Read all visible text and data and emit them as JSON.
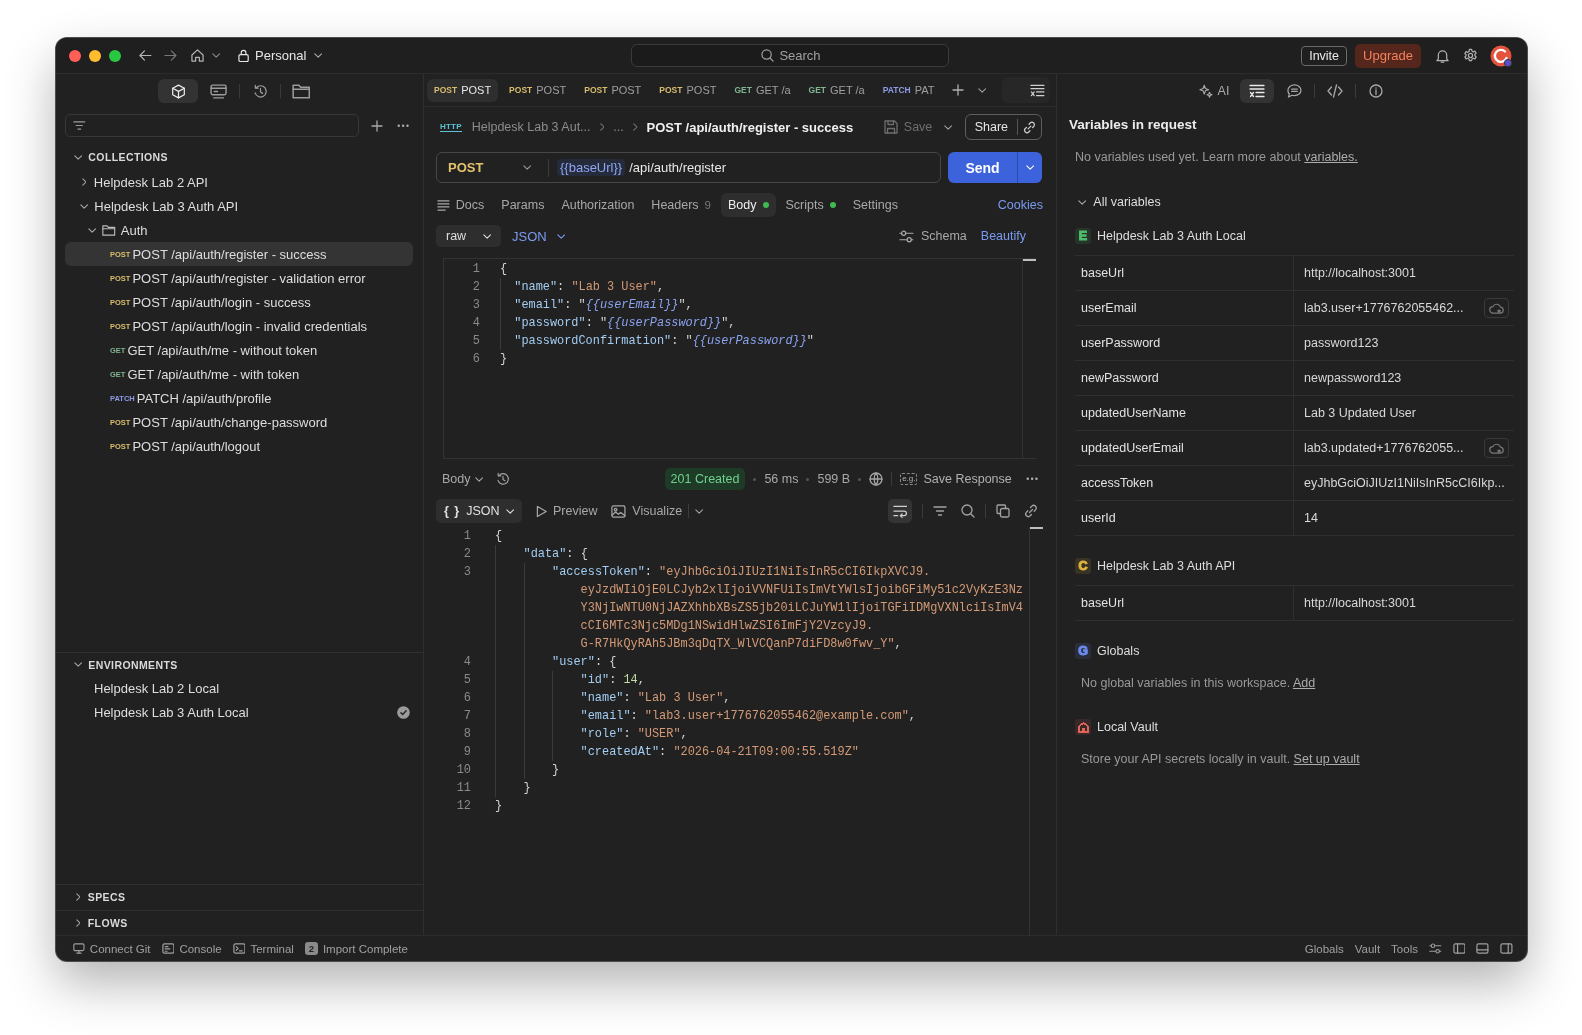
{
  "titlebar": {
    "workspace": "Personal",
    "search": {
      "placeholder": "Search"
    },
    "invite": "Invite",
    "upgrade": "Upgrade"
  },
  "sidebar": {
    "nav": [
      {
        "selected": true
      },
      {
        "selected": false
      },
      {
        "selected": false
      },
      {
        "selected": false
      }
    ],
    "collections": {
      "title": "COLLECTIONS",
      "expanded": true,
      "items": [
        {
          "kind": "collection",
          "name": "Helpdesk Lab 2 API",
          "expanded": false
        },
        {
          "kind": "collection",
          "name": "Helpdesk Lab 3 Auth API",
          "expanded": true,
          "children": [
            {
              "kind": "folder",
              "name": "Auth",
              "expanded": true,
              "children": [
                {
                  "kind": "request",
                  "method": "POST",
                  "color": "#d8bd6e",
                  "name": "POST /api/auth/register - success",
                  "selected": true
                },
                {
                  "kind": "request",
                  "method": "POST",
                  "color": "#d8bd6e",
                  "name": "POST /api/auth/register - validation error",
                  "selected": false
                },
                {
                  "kind": "request",
                  "method": "POST",
                  "color": "#d8bd6e",
                  "name": "POST /api/auth/login - success",
                  "selected": false
                },
                {
                  "kind": "request",
                  "method": "POST",
                  "color": "#d8bd6e",
                  "name": "POST /api/auth/login - invalid credentials",
                  "selected": false
                },
                {
                  "kind": "request",
                  "method": "GET",
                  "color": "#7eb48e",
                  "name": "GET /api/auth/me - without token",
                  "selected": false
                },
                {
                  "kind": "request",
                  "method": "GET",
                  "color": "#7eb48e",
                  "name": "GET /api/auth/me - with token",
                  "selected": false
                },
                {
                  "kind": "request",
                  "method": "PATCH",
                  "color": "#8e9be6",
                  "name": "PATCH /api/auth/profile",
                  "selected": false
                },
                {
                  "kind": "request",
                  "method": "POST",
                  "color": "#d8bd6e",
                  "name": "POST /api/auth/change-password",
                  "selected": false
                },
                {
                  "kind": "request",
                  "method": "POST",
                  "color": "#d8bd6e",
                  "name": "POST /api/auth/logout",
                  "selected": false
                }
              ]
            }
          ]
        }
      ]
    },
    "environments": {
      "title": "ENVIRONMENTS",
      "expanded": true,
      "items": [
        {
          "name": "Helpdesk Lab 2 Local",
          "active": false
        },
        {
          "name": "Helpdesk Lab 3 Auth Local",
          "active": true
        }
      ]
    },
    "sections": [
      {
        "title": "SPECS",
        "expanded": false
      },
      {
        "title": "FLOWS",
        "expanded": false
      }
    ]
  },
  "tabs": [
    {
      "method": "POST",
      "color": "#d8bd6e",
      "label": "POST",
      "selected": true
    },
    {
      "method": "POST",
      "color": "#d8bd6e",
      "label": "POST",
      "selected": false
    },
    {
      "method": "POST",
      "color": "#d8bd6e",
      "label": "POST",
      "selected": false
    },
    {
      "method": "POST",
      "color": "#d8bd6e",
      "label": "POST",
      "selected": false
    },
    {
      "method": "GET",
      "color": "#7eb48e",
      "label": "GET /a",
      "selected": false
    },
    {
      "method": "GET",
      "color": "#7eb48e",
      "label": "GET /a",
      "selected": false
    },
    {
      "method": "PATCH",
      "color": "#8e9be6",
      "label": "PAT",
      "selected": false
    }
  ],
  "request": {
    "protocol": "HTTP",
    "breadcrumb": [
      "Helpdesk Lab 3 Aut...",
      "..."
    ],
    "title": "POST /api/auth/register - success",
    "save": {
      "label": "Save",
      "disabled": true
    },
    "share": "Share",
    "method": {
      "label": "POST",
      "color": "#e2c36c"
    },
    "url": {
      "variable": "{{baseUrl}}",
      "path": "/api/auth/register"
    },
    "send": "Send",
    "tabs": [
      {
        "label": "Docs",
        "selected": false,
        "dot": false
      },
      {
        "label": "Params",
        "selected": false,
        "dot": false
      },
      {
        "label": "Authorization",
        "selected": false,
        "dot": false
      },
      {
        "label": "Headers",
        "count": "9",
        "selected": false,
        "dot": false
      },
      {
        "label": "Body",
        "selected": true,
        "dot": true
      },
      {
        "label": "Scripts",
        "selected": false,
        "dot": true
      },
      {
        "label": "Settings",
        "selected": false,
        "dot": false
      }
    ],
    "cookies": "Cookies",
    "body_mode": "raw",
    "body_language": "JSON",
    "schema": "Schema",
    "beautify": "Beautify",
    "body": [
      {
        "num": "1",
        "tokens": [
          {
            "kind": "punct",
            "text": "{"
          }
        ],
        "children": [
          {
            "num": "2",
            "tokens": [
              {
                "kind": "key",
                "text": "\"name\""
              },
              {
                "kind": "punct",
                "text": ": "
              },
              {
                "kind": "str",
                "text": "\"Lab 3 User\""
              },
              {
                "kind": "punct",
                "text": ","
              }
            ]
          },
          {
            "num": "3",
            "tokens": [
              {
                "kind": "key",
                "text": "\"email\""
              },
              {
                "kind": "punct",
                "text": ": \""
              },
              {
                "kind": "var",
                "text": "{{userEmail}}"
              },
              {
                "kind": "punct",
                "text": "\","
              }
            ]
          },
          {
            "num": "4",
            "tokens": [
              {
                "kind": "key",
                "text": "\"password\""
              },
              {
                "kind": "punct",
                "text": ": \""
              },
              {
                "kind": "var",
                "text": "{{userPassword}}"
              },
              {
                "kind": "punct",
                "text": "\","
              }
            ]
          },
          {
            "num": "5",
            "tokens": [
              {
                "kind": "key",
                "text": "\"passwordConfirmation\""
              },
              {
                "kind": "punct",
                "text": ": \""
              },
              {
                "kind": "var",
                "text": "{{userPassword}}"
              },
              {
                "kind": "punct",
                "text": "\""
              }
            ]
          }
        ],
        "close": {
          "num": "6",
          "tokens": [
            {
              "kind": "punct",
              "text": "}"
            }
          ]
        }
      }
    ]
  },
  "response": {
    "view": "Body",
    "status": "201 Created",
    "time": "56 ms",
    "size": "599 B",
    "save": {
      "icon_text": "e.g.",
      "label": "Save Response"
    },
    "format": {
      "icon_text": "{ }",
      "label": "JSON"
    },
    "preview": "Preview",
    "visualize": "Visualize",
    "wrap_lines": true,
    "body": [
      {
        "num": "1",
        "tokens": [
          {
            "kind": "punct",
            "text": "{"
          }
        ],
        "children": [
          {
            "num": "2",
            "tokens": [
              {
                "kind": "key",
                "text": "\"data\""
              },
              {
                "kind": "punct",
                "text": ": {"
              }
            ],
            "children": [
              {
                "num": "3",
                "tokens": [
                  {
                    "kind": "key",
                    "text": "\"accessToken\""
                  },
                  {
                    "kind": "punct",
                    "text": ": "
                  },
                  {
                    "kind": "str",
                    "text": "\"eyJhbGciOiJIUzI1NiIsInR5cCI6IkpXVCJ9."
                  }
                ],
                "wrap": [
                  {
                    "tokens": [
                      {
                        "kind": "str",
                        "text": "eyJzdWIiOjE0LCJyb2xlIjoiVVNFUiIsImVtYWlsIjoibGFiMy51c2VyKzE3Nz"
                      }
                    ]
                  },
                  {
                    "tokens": [
                      {
                        "kind": "str",
                        "text": "Y3NjIwNTU0NjJAZXhhbXBsZS5jb20iLCJuYW1lIjoiTGFiIDMgVXNlciIsImV4"
                      }
                    ]
                  },
                  {
                    "tokens": [
                      {
                        "kind": "str",
                        "text": "cCI6MTc3Njc5MDg1NSwidHlwZSI6ImFjY2VzcyJ9."
                      }
                    ]
                  },
                  {
                    "tokens": [
                      {
                        "kind": "str",
                        "text": "G-R7HkQyRAh5JBm3qDqTX_WlVCQanP7diFD8w0fwv_Y\""
                      },
                      {
                        "kind": "punct",
                        "text": ","
                      }
                    ]
                  }
                ]
              },
              {
                "num": "4",
                "tokens": [
                  {
                    "kind": "key",
                    "text": "\"user\""
                  },
                  {
                    "kind": "punct",
                    "text": ": {"
                  }
                ],
                "children": [
                  {
                    "num": "5",
                    "tokens": [
                      {
                        "kind": "key",
                        "text": "\"id\""
                      },
                      {
                        "kind": "punct",
                        "text": ": "
                      },
                      {
                        "kind": "num",
                        "text": "14"
                      },
                      {
                        "kind": "punct",
                        "text": ","
                      }
                    ]
                  },
                  {
                    "num": "6",
                    "tokens": [
                      {
                        "kind": "key",
                        "text": "\"name\""
                      },
                      {
                        "kind": "punct",
                        "text": ": "
                      },
                      {
                        "kind": "str",
                        "text": "\"Lab 3 User\""
                      },
                      {
                        "kind": "punct",
                        "text": ","
                      }
                    ]
                  },
                  {
                    "num": "7",
                    "tokens": [
                      {
                        "kind": "key",
                        "text": "\"email\""
                      },
                      {
                        "kind": "punct",
                        "text": ": "
                      },
                      {
                        "kind": "str",
                        "text": "\"lab3.user+1776762055462@example.com\""
                      },
                      {
                        "kind": "punct",
                        "text": ","
                      }
                    ]
                  },
                  {
                    "num": "8",
                    "tokens": [
                      {
                        "kind": "key",
                        "text": "\"role\""
                      },
                      {
                        "kind": "punct",
                        "text": ": "
                      },
                      {
                        "kind": "str",
                        "text": "\"USER\""
                      },
                      {
                        "kind": "punct",
                        "text": ","
                      }
                    ]
                  },
                  {
                    "num": "9",
                    "tokens": [
                      {
                        "kind": "key",
                        "text": "\"createdAt\""
                      },
                      {
                        "kind": "punct",
                        "text": ": "
                      },
                      {
                        "kind": "str",
                        "text": "\"2026-04-21T09:00:55.519Z\""
                      }
                    ]
                  }
                ],
                "close": {
                  "num": "10",
                  "tokens": [
                    {
                      "kind": "punct",
                      "text": "}"
                    }
                  ]
                }
              }
            ],
            "close": {
              "num": "11",
              "tokens": [
                {
                  "kind": "punct",
                  "text": "}"
                }
              ]
            }
          }
        ],
        "close": {
          "num": "12",
          "tokens": [
            {
              "kind": "punct",
              "text": "}"
            }
          ]
        }
      }
    ]
  },
  "variables_panel": {
    "toolbar": [
      {
        "label": "AI",
        "selected": false
      },
      {
        "selected": true
      },
      {
        "selected": false
      },
      {
        "selected": false
      },
      {
        "selected": false
      }
    ],
    "title": "Variables in request",
    "note": {
      "text": "No variables used yet. Learn more about",
      "link": "variables."
    },
    "all_variables": {
      "label": "All variables",
      "expanded": true
    },
    "scopes": [
      {
        "kind": "environment",
        "badge": "E",
        "color": "#4cbb6c",
        "name": "Helpdesk Lab 3 Auth Local",
        "variables": [
          {
            "name": "baseUrl",
            "value": "http://localhost:3001",
            "cloud": false
          },
          {
            "name": "userEmail",
            "value": "lab3.user+1776762055462...",
            "cloud": true
          },
          {
            "name": "userPassword",
            "value": "password123",
            "cloud": false
          },
          {
            "name": "newPassword",
            "value": "newpassword123",
            "cloud": false
          },
          {
            "name": "updatedUserName",
            "value": "Lab 3 Updated User",
            "cloud": false
          },
          {
            "name": "updatedUserEmail",
            "value": "lab3.updated+1776762055...",
            "cloud": true
          },
          {
            "name": "accessToken",
            "value": "eyJhbGciOiJIUzI1NiIsInR5cCI6Ikp...",
            "cloud": false
          },
          {
            "name": "userId",
            "value": "14",
            "cloud": false
          }
        ]
      },
      {
        "kind": "collection",
        "badge": "C",
        "color": "#e0b43c",
        "name": "Helpdesk Lab 3 Auth API",
        "variables": [
          {
            "name": "baseUrl",
            "value": "http://localhost:3001",
            "cloud": false
          }
        ]
      },
      {
        "kind": "globals",
        "badge": "G",
        "color": "#6b8cf0",
        "name": "Globals",
        "note": {
          "text": "No global variables in this workspace.",
          "link": "Add"
        }
      },
      {
        "kind": "vault",
        "color": "#e0645a",
        "name": "Local Vault",
        "note": {
          "text": "Store your API secrets locally in vault.",
          "link": "Set up vault"
        }
      }
    ]
  },
  "status_bar": {
    "left": [
      {
        "label": "Connect Git"
      },
      {
        "label": "Console"
      },
      {
        "label": "Terminal"
      },
      {
        "count": "2",
        "label": "Import Complete"
      }
    ],
    "right": [
      {
        "label": "Globals"
      },
      {
        "label": "Vault"
      },
      {
        "label": "Tools"
      }
    ]
  }
}
